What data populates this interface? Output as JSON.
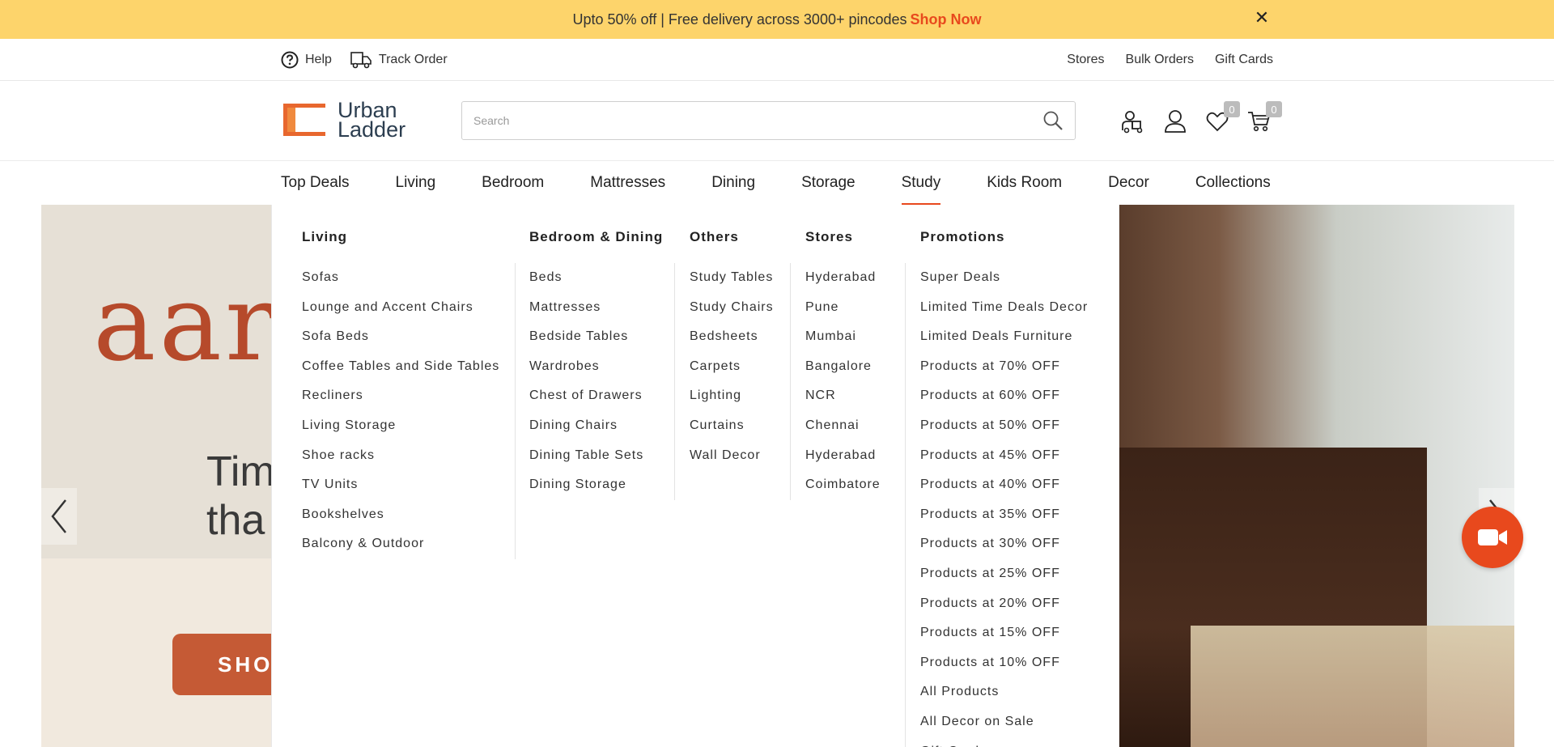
{
  "promo": {
    "text": "Upto 50% off | Free delivery across 3000+ pincodes",
    "cta": "Shop Now",
    "close": "✕"
  },
  "utility": {
    "help": "Help",
    "track_order": "Track Order",
    "stores": "Stores",
    "bulk_orders": "Bulk Orders",
    "gift_cards": "Gift Cards"
  },
  "header": {
    "logo_line1": "Urban",
    "logo_line2": "Ladder",
    "search_placeholder": "Search",
    "wishlist_count": "0",
    "cart_count": "0"
  },
  "nav": {
    "items": [
      "Top Deals",
      "Living",
      "Bedroom",
      "Mattresses",
      "Dining",
      "Storage",
      "Study",
      "Kids Room",
      "Decor",
      "Collections"
    ],
    "active": "Study"
  },
  "hero": {
    "title_fragment": "aara",
    "subtitle_line1": "Tim",
    "subtitle_line2": "tha",
    "cta_fragment": "SHO"
  },
  "mega_menu": {
    "living": {
      "heading": "Living",
      "items": [
        "Sofas",
        "Lounge and Accent Chairs",
        "Sofa Beds",
        "Coffee Tables and Side Tables",
        "Recliners",
        "Living Storage",
        "Shoe racks",
        "TV Units",
        "Bookshelves",
        "Balcony & Outdoor"
      ]
    },
    "bedroom_dining": {
      "heading": "Bedroom & Dining",
      "items": [
        "Beds",
        "Mattresses",
        "Bedside Tables",
        "Wardrobes",
        "Chest of Drawers",
        "Dining Chairs",
        "Dining Table Sets",
        "Dining Storage"
      ]
    },
    "others": {
      "heading": "Others",
      "items": [
        "Study Tables",
        "Study Chairs",
        "Bedsheets",
        "Carpets",
        "Lighting",
        "Curtains",
        "Wall Decor"
      ]
    },
    "stores": {
      "heading": "Stores",
      "items": [
        "Hyderabad",
        "Pune",
        "Mumbai",
        "Bangalore",
        "NCR",
        "Chennai",
        "Hyderabad",
        "Coimbatore"
      ]
    },
    "promotions": {
      "heading": "Promotions",
      "items": [
        "Super Deals",
        "Limited Time Deals Decor",
        "Limited Deals Furniture",
        "Products at 70% OFF",
        "Products at 60% OFF",
        "Products at 50% OFF",
        "Products at 45% OFF",
        "Products at 40% OFF",
        "Products at 35% OFF",
        "Products at 30% OFF",
        "Products at 25% OFF",
        "Products at 20% OFF",
        "Products at 15% OFF",
        "Products at 10% OFF",
        "All Products",
        "All Decor on Sale",
        "Gift Card"
      ]
    }
  },
  "colors": {
    "promo_bg": "#fdd46b",
    "accent": "#e8491d",
    "logo_dark": "#2c3e50"
  },
  "icons": [
    "close-icon",
    "help-icon",
    "truck-icon",
    "search-icon",
    "delivery-icon",
    "user-icon",
    "heart-icon",
    "cart-icon",
    "chevron-left-icon",
    "chevron-right-icon",
    "video-camera-icon"
  ]
}
